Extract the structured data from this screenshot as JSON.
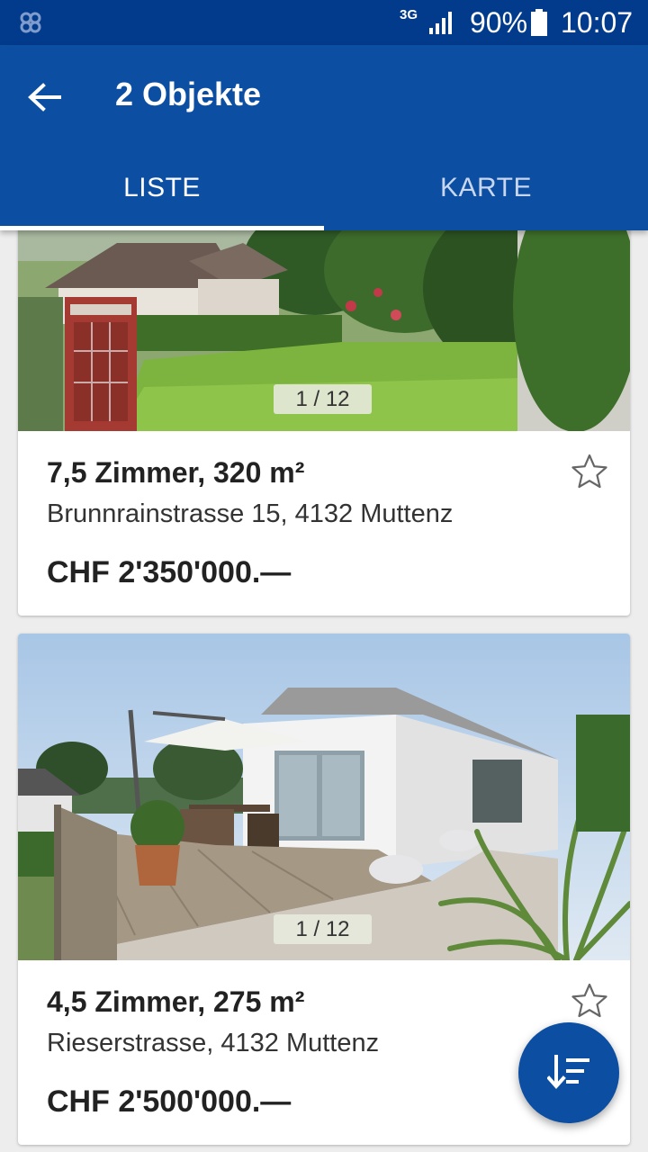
{
  "status_bar": {
    "network": "3G",
    "battery": "90%",
    "time": "10:07"
  },
  "app_bar": {
    "title": "2 Objekte",
    "tabs": [
      {
        "label": "LISTE",
        "active": true
      },
      {
        "label": "KARTE",
        "active": false
      }
    ]
  },
  "listings": [
    {
      "photo_counter": "1 / 12",
      "rooms_area": "7,5 Zimmer, 320 m²",
      "address": "Brunnrainstrasse 15, 4132 Muttenz",
      "price": "CHF 2'350'000.—"
    },
    {
      "photo_counter": "1 / 12",
      "rooms_area": "4,5 Zimmer, 275 m²",
      "address": "Rieserstrasse, 4132 Muttenz",
      "price": "CHF 2'500'000.—"
    }
  ],
  "colors": {
    "status_bar": "#033b8c",
    "app_bar": "#0b4ea2",
    "background": "#ededed",
    "fab": "#0b4ea2"
  },
  "icons": {
    "back": "arrow-left-icon",
    "favorite": "star-outline-icon",
    "sort": "sort-icon"
  }
}
